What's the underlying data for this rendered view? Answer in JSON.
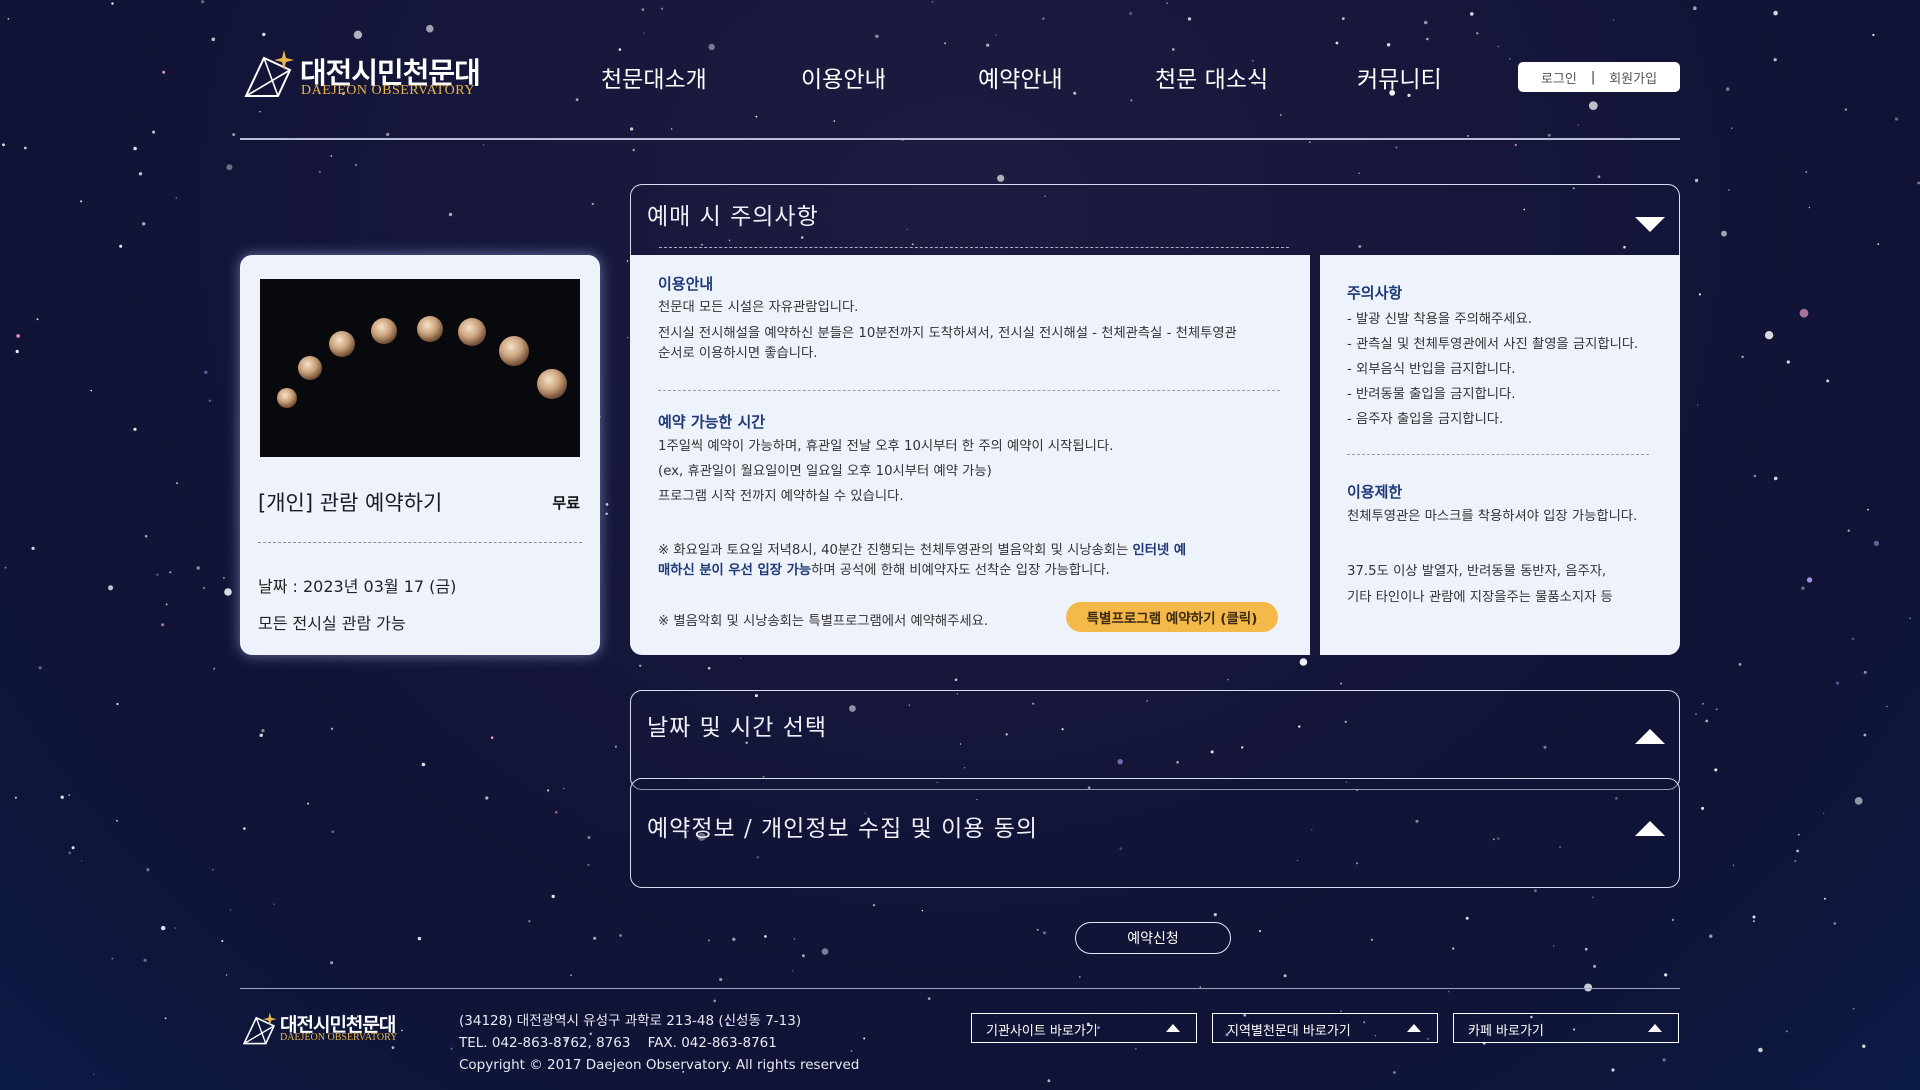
{
  "header": {
    "logo_title": "대전시민천문대",
    "logo_sub": "DAEJEON OBSERVATORY",
    "nav": [
      "천문대소개",
      "이용안내",
      "예약안내",
      "천문 대소식",
      "커뮤니티"
    ],
    "login": "로그인",
    "separator": "|",
    "signup": "회원가입"
  },
  "card": {
    "title": "[개인] 관람 예약하기",
    "price": "무료",
    "date": "날짜 : 2023년 03월 17 (금)",
    "note": "모든 전시실 관람 가능"
  },
  "notice": {
    "title": "예매 시 주의사항",
    "usage_heading": "이용안내",
    "usage_lines": [
      "천문대 모든 시설은 자유관람입니다.",
      "전시실 전시해설을 예약하신 분들은 10분전까지 도착하셔서, 전시실 전시해설 - 천체관측실 - 천체투영관",
      "순서로 이용하시면 좋습니다."
    ],
    "time_heading": "예약 가능한 시간",
    "time_lines": [
      "1주일씩 예약이 가능하며, 휴관일 전날 오후 10시부터 한 주의 예약이 시작됩니다.",
      "(ex, 휴관일이 월요일이면 일요일 오후 10시부터 예약 가능)",
      "프로그램 시작 전까지 예약하실 수 있습니다."
    ],
    "music_pre": "※ 화요일과 토요일 저녁8시, 40분간 진행되는 천체투영관의 별음악회 및 시낭송회는 ",
    "music_hl1": "인터넷 예",
    "music_hl2": "매하신 분이 우선 입장 가능",
    "music_post": "하며 공석에 한해 비예약자도 선착순 입장 가능합니다.",
    "special_note": "※ 별음악회 및 시낭송회는 특별프로그램에서 예약해주세요.",
    "special_button": "특별프로그램 예약하기 (클릭)",
    "caution_heading": "주의사항",
    "caution_lines": [
      "- 발광 신발 착용을 주의해주세요.",
      "- 관측실 및 천체투영관에서 사진 촬영을 금지합니다.",
      "- 외부음식 반입을 금지합니다.",
      "- 반려동물 출입을 금지합니다.",
      "- 음주자 출입을 금지합니다."
    ],
    "limit_heading": "이용제한",
    "limit_line1": "천체투영관은 마스크를 착용하셔야 입장 가능합니다.",
    "limit_line2": "37.5도 이상 발열자, 반려동물 동반자, 음주자,",
    "limit_line3": "기타 타인이나 관람에 지장을주는 물품소지자 등"
  },
  "sections": {
    "datetime_title": "날짜 및 시간 선택",
    "consent_title": "예약정보 / 개인정보 수집 및 이용 동의"
  },
  "submit_label": "예약신청",
  "footer": {
    "logo_title": "대전시민천문대",
    "logo_sub": "DAEJEON OBSERVATORY",
    "address": "(34128) 대전광역시 유성구 과학로 213-48 (신성동 7-13)",
    "tel": "TEL. 042-863-8762, 8763    FAX. 042-863-8761",
    "copyright": "Copyright © 2017 Daejeon Observatory. All rights reserved",
    "selects": [
      "기관사이트 바로가기",
      "지역별천문대 바로가기",
      "카페 바로가기"
    ]
  },
  "colors": {
    "background": "#15163a",
    "panel": "#eef2fb",
    "accent_heading": "#1e3a78",
    "button_accent": "#f4b949",
    "logo_gold": "#e8b64a"
  }
}
